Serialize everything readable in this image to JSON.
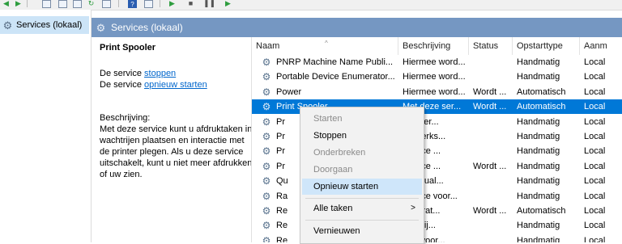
{
  "toolbar": {
    "icons": [
      "back-icon",
      "forward-icon",
      "console-tree-icon",
      "properties-icon",
      "export-icon",
      "refresh-icon",
      "help-icon",
      "list-icon",
      "play-icon",
      "stop-icon",
      "pause-icon",
      "resume-icon"
    ]
  },
  "tree": {
    "item_label": "Services (lokaal)"
  },
  "banner": {
    "title": "Services (lokaal)"
  },
  "desc": {
    "service_name": "Print Spooler",
    "line1_prefix": "De service ",
    "stop_link": "stoppen",
    "line2_prefix": "De service ",
    "restart_link": "opnieuw starten",
    "desc_label": "Beschrijving:",
    "desc_text": "Met deze service kunt u afdruktaken in wachtrijen plaatsen en interactie met de printer plegen. Als u deze service uitschakelt, kunt u niet meer afdrukken of uw zien."
  },
  "columns": [
    "Naam",
    "Beschrijving",
    "Status",
    "Opstarttype",
    "Aanm"
  ],
  "rows": [
    {
      "name": "PNRP Machine Name Publi...",
      "desc": "Hiermee word...",
      "status": "",
      "startup": "Handmatig",
      "logon": "Local"
    },
    {
      "name": "Portable Device Enumerator...",
      "desc": "Hiermee word...",
      "status": "",
      "startup": "Handmatig",
      "logon": "Local"
    },
    {
      "name": "Power",
      "desc": "Hiermee word...",
      "status": "Wordt ...",
      "startup": "Automatisch",
      "logon": "Local"
    },
    {
      "name": "Print Spooler",
      "desc": "Met deze ser...",
      "status": "Wordt ...",
      "startup": "Automatisch",
      "logon": "Local"
    },
    {
      "name": "Pr",
      "desc": "eze ser...",
      "status": "",
      "startup": "Handmatig",
      "logon": "Local"
    },
    {
      "name": "Pr",
      "desc": "rukwerks...",
      "status": "",
      "startup": "Handmatig",
      "logon": "Local"
    },
    {
      "name": "Pr",
      "desc": "service ...",
      "status": "",
      "startup": "Handmatig",
      "logon": "Local"
    },
    {
      "name": "Pr",
      "desc": "service ...",
      "status": "Wordt ...",
      "startup": "Handmatig",
      "logon": "Local"
    },
    {
      "name": "Qu",
      "desc": "ve (Qual...",
      "status": "",
      "startup": "Handmatig",
      "logon": "Local"
    },
    {
      "name": "Ra",
      "desc": "service voor...",
      "status": "",
      "startup": "Handmatig",
      "logon": "Local"
    },
    {
      "name": "Re",
      "desc": "oeperat...",
      "status": "Wordt ...",
      "startup": "Automatisch",
      "logon": "Local"
    },
    {
      "name": "Re",
      "desc": "nschrij...",
      "status": "",
      "startup": "Handmatig",
      "logon": "Local"
    },
    {
      "name": "Re",
      "desc": "vice voor...",
      "status": "",
      "startup": "Handmatig",
      "logon": "Local"
    }
  ],
  "context_menu": {
    "start": "Starten",
    "stop": "Stoppen",
    "pause": "Onderbreken",
    "resume": "Doorgaan",
    "restart": "Opnieuw starten",
    "all_tasks": "Alle taken",
    "refresh": "Vernieuwen"
  }
}
